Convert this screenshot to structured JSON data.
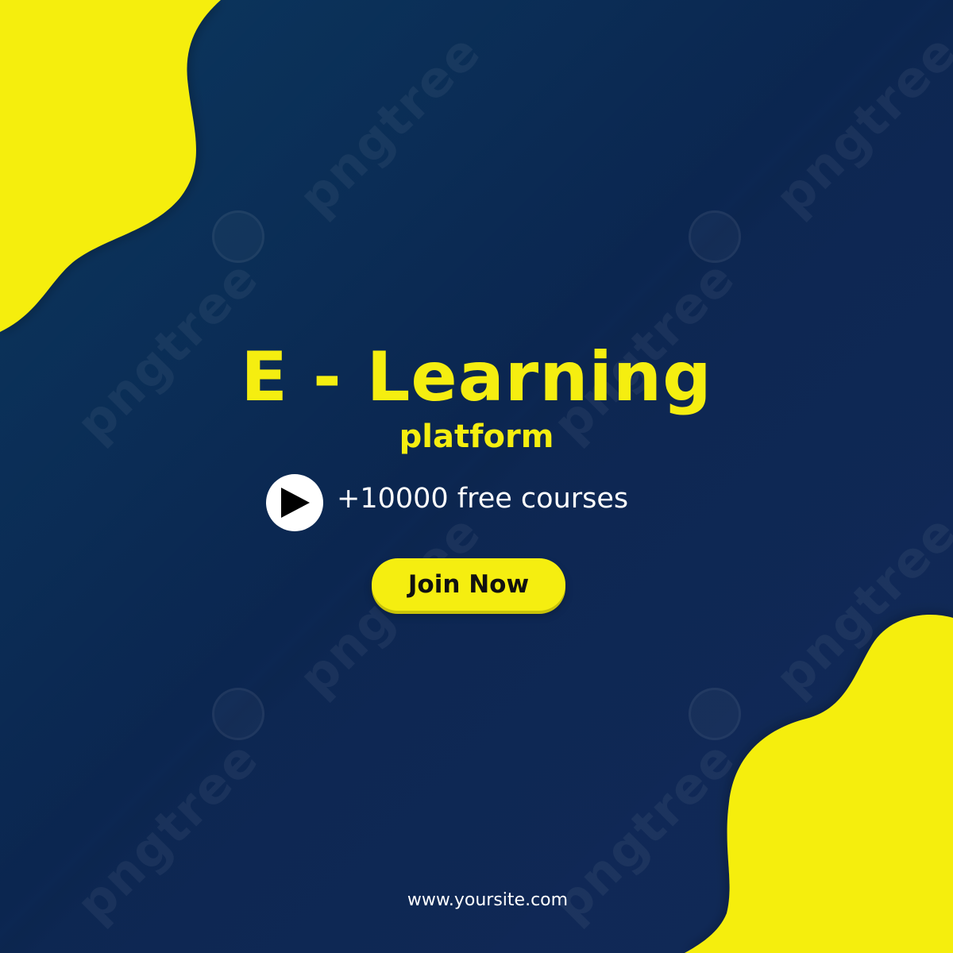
{
  "poster": {
    "title": "E - Learning",
    "subtitle": "platform",
    "courses_text": "+10000 free courses",
    "cta_label": "Join Now",
    "website": "www.yoursite.com",
    "watermark": "pngtree"
  },
  "colors": {
    "background": "#0b2650",
    "accent_yellow": "#f5ee10",
    "text_white": "#ffffff",
    "play_triangle": "#000000"
  },
  "icons": {
    "play": "play-icon",
    "watermark_logo": "pngtree-logo-icon"
  }
}
